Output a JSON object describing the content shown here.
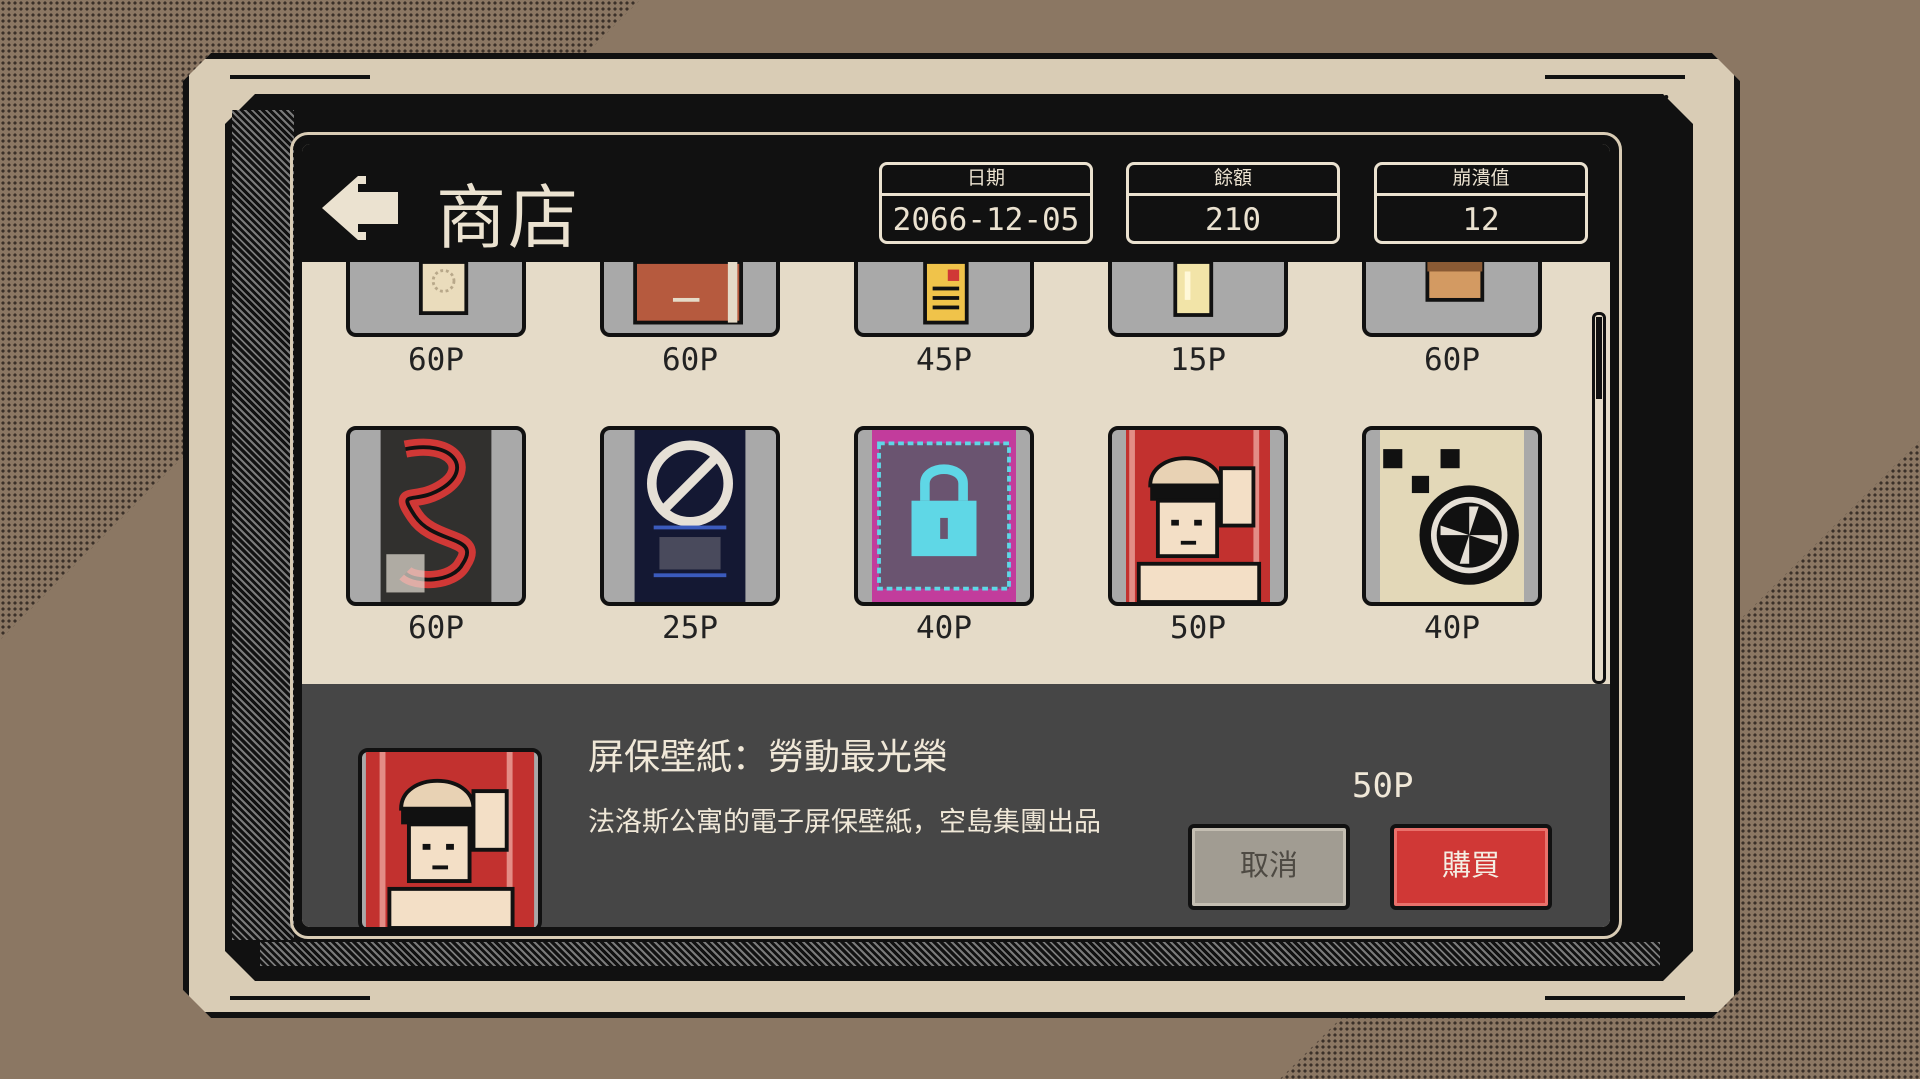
{
  "header": {
    "title": "商店",
    "stats": [
      {
        "label": "日期",
        "value": "2066-12-05"
      },
      {
        "label": "餘額",
        "value": "210"
      },
      {
        "label": "崩潰值",
        "value": "12"
      }
    ]
  },
  "shop": {
    "row1": [
      {
        "price": "60P",
        "icon": "keycard-icon"
      },
      {
        "price": "60P",
        "icon": "book-icon"
      },
      {
        "price": "45P",
        "icon": "document-icon"
      },
      {
        "price": "15P",
        "icon": "drink-glass-icon"
      },
      {
        "price": "60P",
        "icon": "box-icon"
      }
    ],
    "row2": [
      {
        "price": "60P",
        "icon": "red-dragon-wallpaper-icon"
      },
      {
        "price": "25P",
        "icon": "no-sign-wallpaper-icon"
      },
      {
        "price": "40P",
        "icon": "padlock-wallpaper-icon"
      },
      {
        "price": "50P",
        "icon": "worker-salute-wallpaper-icon"
      },
      {
        "price": "40P",
        "icon": "fan-wallpaper-icon"
      }
    ]
  },
  "detail": {
    "name": "屏保壁紙：勞動最光榮",
    "description": "法洛斯公寓的電子屏保壁紙，空島集團出品",
    "price": "50P",
    "cancel_label": "取消",
    "buy_label": "購買"
  },
  "colors": {
    "frame": "#d9ccb5",
    "screen": "#e5dbc8",
    "header": "#111111",
    "panel": "#464646",
    "buy": "#d03836",
    "cancel": "#a19c92"
  }
}
